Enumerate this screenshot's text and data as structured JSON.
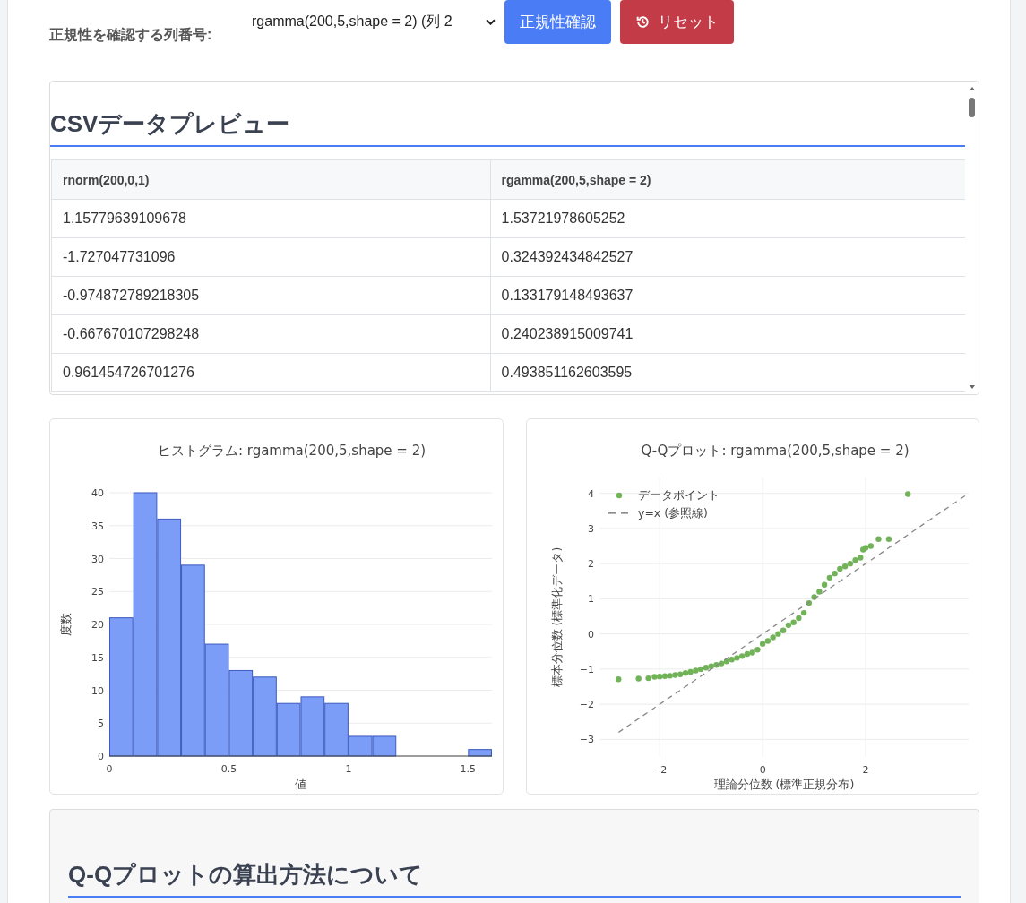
{
  "controls": {
    "column_label": "正規性を確認する列番号:",
    "column_select": {
      "value": "rgamma(200,5,shape = 2) (列 2"
    },
    "buttons": [
      {
        "kind": "primary",
        "label": "正規性確認"
      },
      {
        "kind": "reset",
        "label": "リセット"
      }
    ]
  },
  "preview": {
    "title": "CSVデータプレビュー",
    "columns": [
      "rnorm(200,0,1)",
      "rgamma(200,5,shape = 2)"
    ],
    "rows": [
      [
        "1.15779639109678",
        "1.53721978605252"
      ],
      [
        "-1.727047731096",
        "0.324392434842527"
      ],
      [
        "-0.974872789218305",
        "0.133179148493637"
      ],
      [
        "-0.667670107298248",
        "0.240238915009741"
      ],
      [
        "0.961454726701276",
        "0.493851162603595"
      ]
    ]
  },
  "histogram": {
    "chart_data": {
      "type": "bar",
      "title": "ヒストグラム: rgamma(200,5,shape = 2)",
      "xlabel": "値",
      "ylabel": "度数",
      "x": [
        0.05,
        0.15,
        0.25,
        0.35,
        0.45,
        0.55,
        0.65,
        0.75,
        0.85,
        0.95,
        1.05,
        1.15,
        1.25,
        1.35,
        1.45,
        1.55
      ],
      "grid": true,
      "series": [
        {
          "color": "#7b9cf7",
          "values": [
            21,
            40,
            36,
            29,
            17,
            13,
            12,
            8,
            9,
            8,
            3,
            3,
            0,
            0,
            0,
            1
          ]
        }
      ],
      "xlim": [
        0,
        1.6
      ],
      "ylim": [
        0,
        40
      ],
      "xticks": [
        0,
        0.5,
        1,
        1.5
      ],
      "yticks": [
        0,
        5,
        10,
        15,
        20,
        25,
        30,
        35,
        40
      ]
    }
  },
  "qqplot": {
    "chart_data": {
      "type": "scatter",
      "title": "Q-Qプロット: rgamma(200,5,shape = 2)",
      "xlabel": "理論分位数 (標準正規分布)",
      "ylabel": "標本分位数 (標準化データ)",
      "x": [
        -2.8,
        -2.41,
        -2.22,
        -2.1,
        -2.0,
        -1.9,
        -1.8,
        -1.7,
        -1.6,
        -1.5,
        -1.4,
        -1.3,
        -1.2,
        -1.1,
        -1.0,
        -0.9,
        -0.8,
        -0.7,
        -0.6,
        -0.5,
        -0.4,
        -0.3,
        -0.2,
        -0.1,
        0,
        0.1,
        0.2,
        0.3,
        0.4,
        0.5,
        0.6,
        0.7,
        0.8,
        0.9,
        1.0,
        1.1,
        1.2,
        1.3,
        1.4,
        1.5,
        1.6,
        1.7,
        1.8,
        1.9,
        1.95,
        2.0,
        2.1,
        2.25,
        2.45,
        2.82
      ],
      "series": [
        {
          "name": "データポイント",
          "color": "#72b35a",
          "values": [
            -1.29,
            -1.27,
            -1.26,
            -1.22,
            -1.21,
            -1.2,
            -1.19,
            -1.17,
            -1.15,
            -1.11,
            -1.08,
            -1.04,
            -1.0,
            -0.96,
            -0.92,
            -0.88,
            -0.84,
            -0.78,
            -0.73,
            -0.68,
            -0.63,
            -0.57,
            -0.53,
            -0.45,
            -0.28,
            -0.2,
            -0.1,
            0.0,
            0.1,
            0.25,
            0.33,
            0.45,
            0.6,
            0.88,
            1.05,
            1.2,
            1.4,
            1.6,
            1.72,
            1.85,
            1.92,
            2.0,
            2.1,
            2.17,
            2.4,
            2.45,
            2.5,
            2.7,
            2.7,
            3.98
          ]
        },
        {
          "name": "y=x (参照線)",
          "color": "#888888",
          "type": "line",
          "line_style": "dashed",
          "x": [
            -2.8,
            4.0
          ],
          "values": [
            -2.8,
            4.0
          ]
        }
      ],
      "legend": true,
      "grid": true,
      "xlim": [
        -3.17,
        4
      ],
      "ylim": [
        -3.5,
        4.45
      ],
      "xticks": [
        -2,
        0,
        2
      ],
      "yticks": [
        -3,
        -2,
        -1,
        0,
        1,
        2,
        3,
        4
      ]
    }
  },
  "method": {
    "title": "Q-Qプロットの算出方法について"
  }
}
